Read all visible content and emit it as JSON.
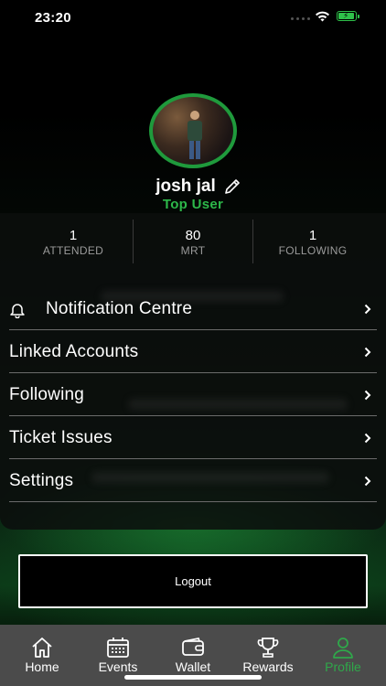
{
  "status_bar": {
    "time": "23:20"
  },
  "profile": {
    "name": "josh jal",
    "badge": "Top User"
  },
  "stats": [
    {
      "value": "1",
      "label": "ATTENDED"
    },
    {
      "value": "80",
      "label": "MRT"
    },
    {
      "value": "1",
      "label": "FOLLOWING"
    }
  ],
  "menu": {
    "items": [
      {
        "label": "Notification Centre",
        "icon": "bell-icon"
      },
      {
        "label": "Linked Accounts"
      },
      {
        "label": "Following"
      },
      {
        "label": "Ticket Issues"
      },
      {
        "label": "Settings"
      }
    ]
  },
  "logout_label": "Logout",
  "tabs": [
    {
      "label": "Home",
      "icon": "home-icon"
    },
    {
      "label": "Events",
      "icon": "calendar-icon"
    },
    {
      "label": "Wallet",
      "icon": "wallet-icon"
    },
    {
      "label": "Rewards",
      "icon": "trophy-icon"
    },
    {
      "label": "Profile",
      "icon": "person-icon",
      "active": true
    }
  ],
  "colors": {
    "accent": "#2db84a",
    "tabbar": "#4b4b4b",
    "background": "#000000"
  }
}
